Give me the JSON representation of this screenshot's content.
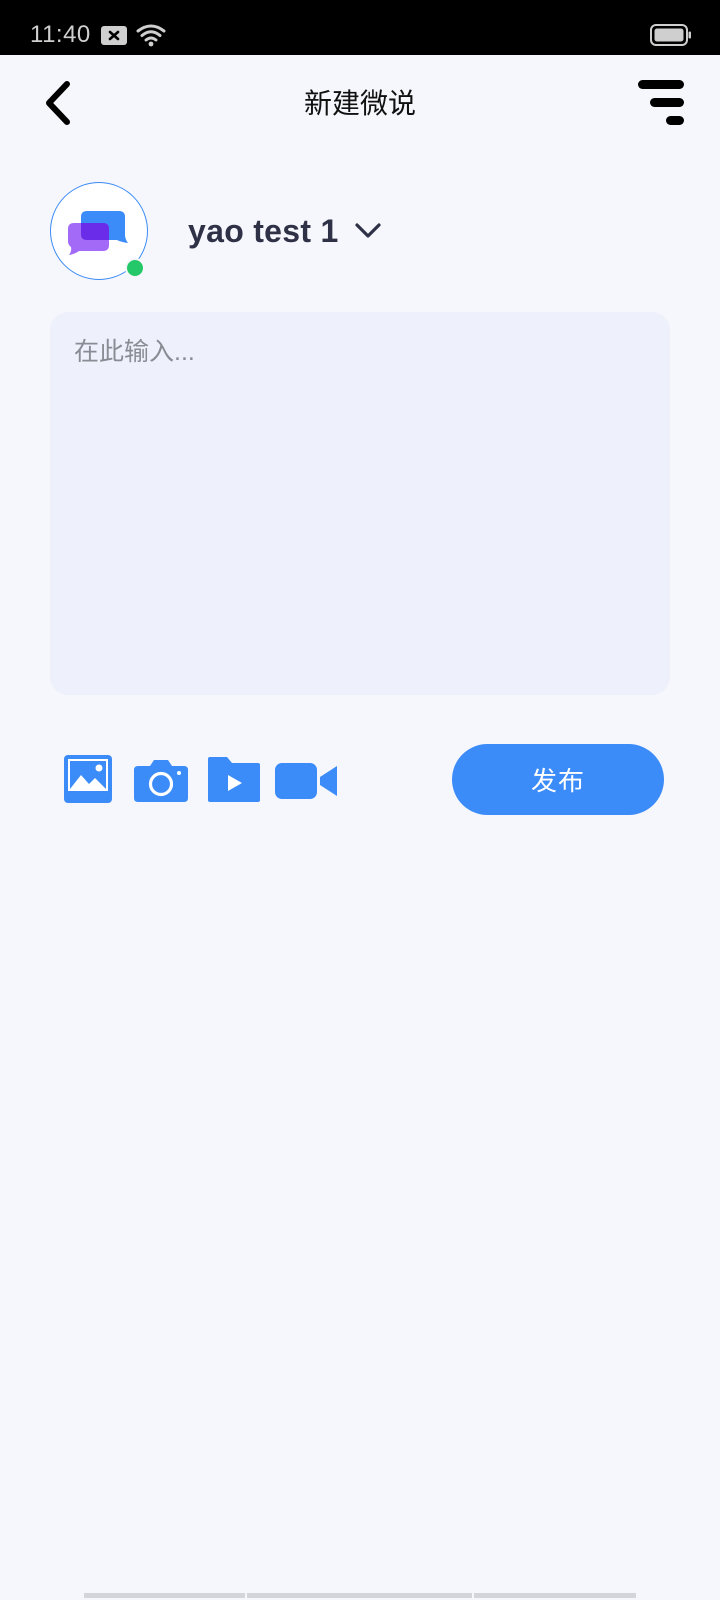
{
  "status_bar": {
    "time": "11:40"
  },
  "header": {
    "title": "新建微说"
  },
  "account": {
    "name": "yao test 1"
  },
  "compose": {
    "placeholder": "在此输入..."
  },
  "toolbar": {
    "publish_label": "发布"
  },
  "colors": {
    "accent": "#3B8BF8",
    "online": "#25C868",
    "background": "#F6F7FC",
    "input_background": "#EEF1FC"
  }
}
